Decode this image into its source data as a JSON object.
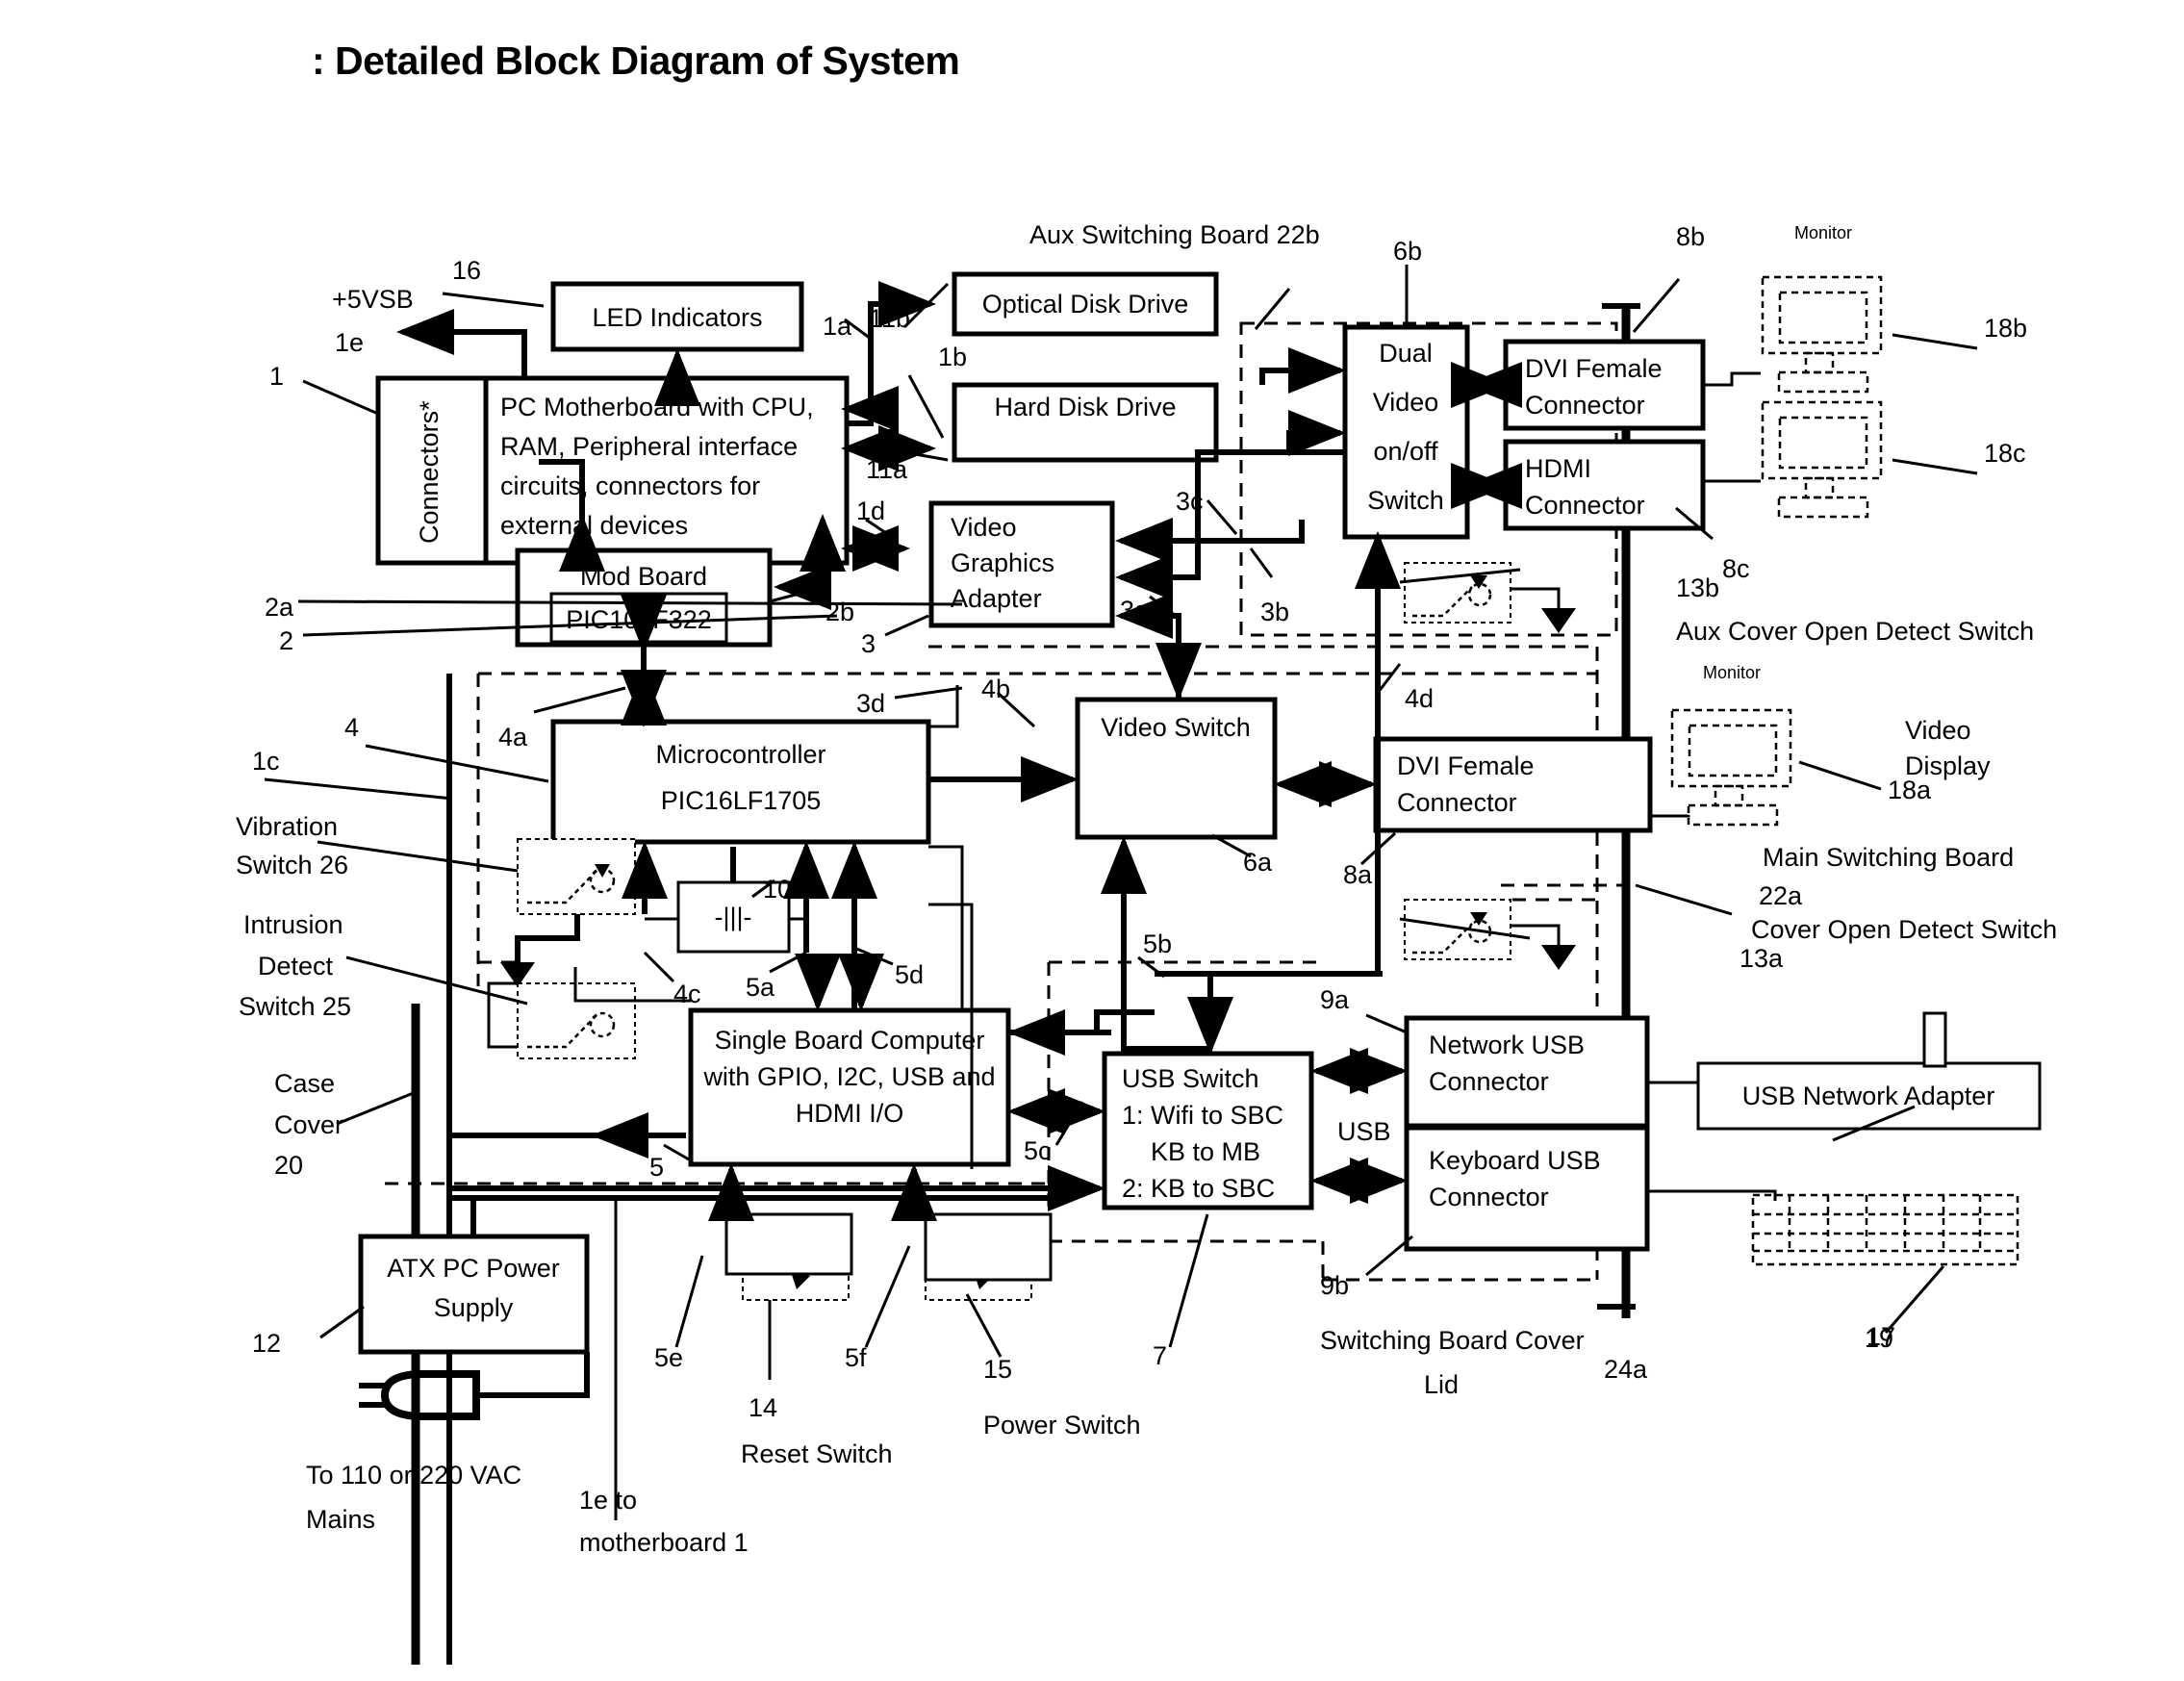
{
  "title": ": Detailed Block Diagram of System",
  "blocks": {
    "led_indicators": "LED Indicators",
    "connectors": "Connectors*",
    "motherboard_l1": "PC Motherboard with CPU,",
    "motherboard_l2": "RAM, Peripheral interface",
    "motherboard_l3": "circuits, connectors for",
    "motherboard_l4": "external devices",
    "mod_board": "Mod Board",
    "pic10lf322": "PIC10LF322",
    "optical_disk_drive": "Optical Disk Drive",
    "hard_disk_drive": "Hard Disk Drive",
    "vga_l1": "Video",
    "vga_l2": "Graphics",
    "vga_l3": "Adapter",
    "dual_video_l1": "Dual",
    "dual_video_l2": "Video",
    "dual_video_l3": "on/off",
    "dual_video_l4": "Switch",
    "dvi_female_top_l1": "DVI  Female",
    "dvi_female_top_l2": "Connector",
    "hdmi_l1": "HDMI",
    "hdmi_l2": "Connector",
    "microcontroller_l1": "Microcontroller",
    "microcontroller_l2": "PIC16LF1705",
    "video_switch": "Video Switch",
    "dvi_female_mid_l1": "DVI Female",
    "dvi_female_mid_l2": "Connector",
    "battery": "-|||-",
    "sbc_l1": "Single Board Computer",
    "sbc_l2": "with GPIO, I2C, USB and",
    "sbc_l3": "HDMI I/O",
    "usb_switch_l1": "USB Switch",
    "usb_switch_l2": "1: Wifi to SBC",
    "usb_switch_l3": "KB to MB",
    "usb_switch_l4": "2: KB to SBC",
    "network_usb_l1": "Network USB",
    "network_usb_l2": "Connector",
    "keyboard_usb_l1": "Keyboard USB",
    "keyboard_usb_l2": "Connector",
    "usb_network_adapter": "USB Network  Adapter",
    "atx_psu_l1": "ATX PC Power",
    "atx_psu_l2": "Supply"
  },
  "labels": {
    "plus5vsb": "+5VSB",
    "n1e": "1e",
    "n16": "16",
    "n1": "1",
    "n1a": "1a",
    "n1b": "1b",
    "n1c": "1c",
    "n1d": "1d",
    "n2": "2",
    "n2a": "2a",
    "n2b": "2b",
    "n3": "3",
    "n3a": "3a",
    "n3b": "3b",
    "n3c": "3c",
    "n3d": "3d",
    "n4": "4",
    "n4a": "4a",
    "n4b": "4b",
    "n4c": "4c",
    "n4d": "4d",
    "n5": "5",
    "n5a": "5a",
    "n5b": "5b",
    "n5c": "5c",
    "n5d": "5d",
    "n5e": "5e",
    "n5f": "5f",
    "n6a": "6a",
    "n6b": "6b",
    "n7": "7",
    "n8a": "8a",
    "n8b": "8b",
    "n8c": "8c",
    "n9a": "9a",
    "n9b": "9b",
    "n10": "10",
    "n11a": "11a",
    "n11b": "11b",
    "n12": "12",
    "n13a": "13a",
    "n13b": "13b",
    "n14": "14",
    "n15": "15",
    "n17": "17",
    "n18a": "18a",
    "n18b": "18b",
    "n18c": "18c",
    "n19": "19",
    "n22a": "22a",
    "n24a": "24a",
    "usb_text": "USB",
    "aux_switching_board": "Aux Switching Board 22b",
    "aux_cover_open": "Aux Cover Open Detect Switch",
    "main_switching_board": "Main Switching Board",
    "cover_open_detect": "Cover Open Detect Switch",
    "video_display_l1": "Video",
    "video_display_l2": "Display",
    "vibration_l1": "Vibration",
    "vibration_l2": "Switch 26",
    "intrusion_l1": "Intrusion",
    "intrusion_l2": "Detect",
    "intrusion_l3": "Switch 25",
    "case_cover_l1": "Case",
    "case_cover_l2": "Cover",
    "case_cover_l3": "20",
    "mains_l1": "To 110 or 220 VAC",
    "mains_l2": "Mains",
    "reset_switch": "Reset Switch",
    "power_switch": "Power Switch",
    "switching_cover_l1": "Switching Board Cover",
    "switching_cover_l2": "Lid",
    "monitor_top": "Monitor",
    "monitor_mid": "Monitor",
    "n1e_to_l1": "1e to",
    "n1e_to_l2": "motherboard 1"
  }
}
